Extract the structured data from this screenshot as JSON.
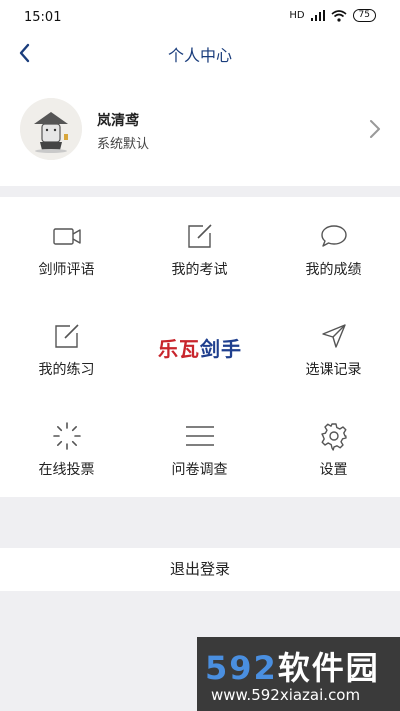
{
  "status_bar": {
    "time": "15:01",
    "network": "HD",
    "battery": "75"
  },
  "nav": {
    "title": "个人中心"
  },
  "profile": {
    "name": "岚清鸢",
    "subtitle": "系统默认"
  },
  "grid": [
    {
      "label": "剑师评语",
      "icon": "video-icon"
    },
    {
      "label": "我的考试",
      "icon": "edit-icon"
    },
    {
      "label": "我的成绩",
      "icon": "chat-bubble-icon"
    },
    {
      "label": "我的练习",
      "icon": "edit-icon"
    },
    {
      "label": "选课记录",
      "icon": "send-icon"
    },
    {
      "label": "在线投票",
      "icon": "loading-spinner-icon"
    },
    {
      "label": "问卷调查",
      "icon": "menu-lines-icon"
    },
    {
      "label": "设置",
      "icon": "gear-icon"
    }
  ],
  "logo": {
    "part1": "乐瓦",
    "part2": "剑手"
  },
  "logout": {
    "label": "退出登录"
  },
  "watermark": {
    "brand_digits": "592",
    "brand_text": "软件园",
    "url": "www.592xiazai.com"
  },
  "colors": {
    "nav_title": "#1a3d7c",
    "logo_red": "#c8252c",
    "logo_blue": "#1f3f8e",
    "background": "#efeff2"
  }
}
